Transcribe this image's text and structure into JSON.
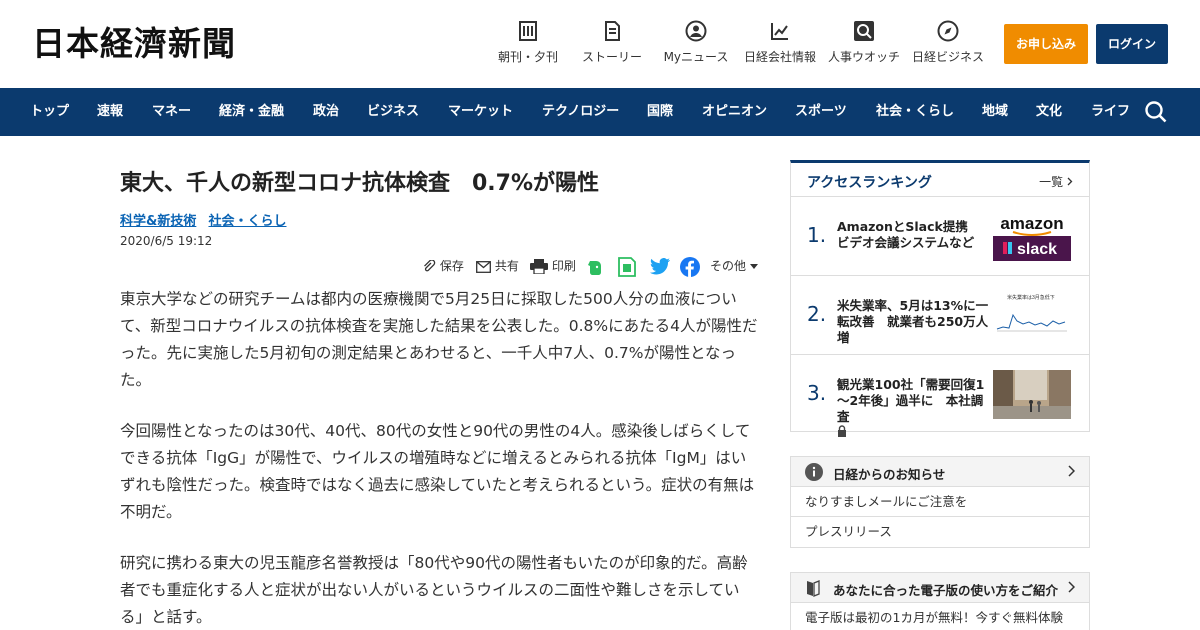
{
  "header": {
    "logo": "日本経濟新聞",
    "nav": [
      {
        "label": "朝刊・夕刊",
        "icon": "newspaper-icon"
      },
      {
        "label": "ストーリー",
        "icon": "story-icon"
      },
      {
        "label": "Myニュース",
        "icon": "user-icon"
      },
      {
        "label": "日経会社情報",
        "icon": "chart-icon"
      },
      {
        "label": "人事ウオッチ",
        "icon": "search-person-icon"
      },
      {
        "label": "日経ビジネス",
        "icon": "compass-icon"
      }
    ],
    "apply_label": "お申し込み",
    "login_label": "ログイン",
    "colors": {
      "brand": "#0b3a6e",
      "apply": "#f08c00"
    }
  },
  "mainnav": {
    "items": [
      "トップ",
      "速報",
      "マネー",
      "経済・金融",
      "政治",
      "ビジネス",
      "マーケット",
      "テクノロジー",
      "国際",
      "オピニオン",
      "スポーツ",
      "社会・くらし",
      "地域",
      "文化",
      "ライフ"
    ]
  },
  "article": {
    "title": "東大、千人の新型コロナ抗体検査　0.7%が陽性",
    "tags": [
      "科学&新技術",
      "社会・くらし"
    ],
    "date": "2020/6/5 19:12",
    "share": {
      "save": "保存",
      "share": "共有",
      "print": "印刷",
      "more": "その他"
    },
    "paragraphs": [
      "東京大学などの研究チームは都内の医療機関で5月25日に採取した500人分の血液について、新型コロナウイルスの抗体検査を実施した結果を公表した。0.8%にあたる4人が陽性だった。先に実施した5月初旬の測定結果とあわせると、一千人中7人、0.7%が陽性となった。",
      "今回陽性となったのは30代、40代、80代の女性と90代の男性の4人。感染後しばらくしてできる抗体「IgG」が陽性で、ウイルスの増殖時などに増えるとみられる抗体「IgM」はいずれも陰性だった。検査時ではなく過去に感染していたと考えられるという。症状の有無は不明だ。",
      "研究に携わる東大の児玉龍彦名誉教授は「80代や90代の陽性者もいたのが印象的だ。高齢者でも重症化する人と症状が出ない人がいるというウイルスの二面性や難しさを示している」と話す。"
    ]
  },
  "sidebar": {
    "ranking": {
      "title": "アクセスランキング",
      "more": "一覧",
      "items": [
        {
          "no": "1.",
          "text": "AmazonとSlack提携　ビデオ会議システムなど",
          "thumb_text_1": "amazon",
          "thumb_text_2": "slack"
        },
        {
          "no": "2.",
          "text": "米失業率、5月は13%に一転改善　就業者も250万人増",
          "thumb_caption": "米失業率は3月急低下"
        },
        {
          "no": "3.",
          "text": "観光業100社「需要回復1～2年後」過半に　本社調査"
        }
      ]
    },
    "notice": {
      "title": "日経からのお知らせ",
      "rows": [
        "なりすましメールにご注意を",
        "プレスリリース"
      ]
    },
    "guide": {
      "title": "あなたに合った電子版の使い方をご紹介",
      "rows": [
        "電子版は最初の1カ月が無料！今すぐ無料体験"
      ]
    }
  }
}
